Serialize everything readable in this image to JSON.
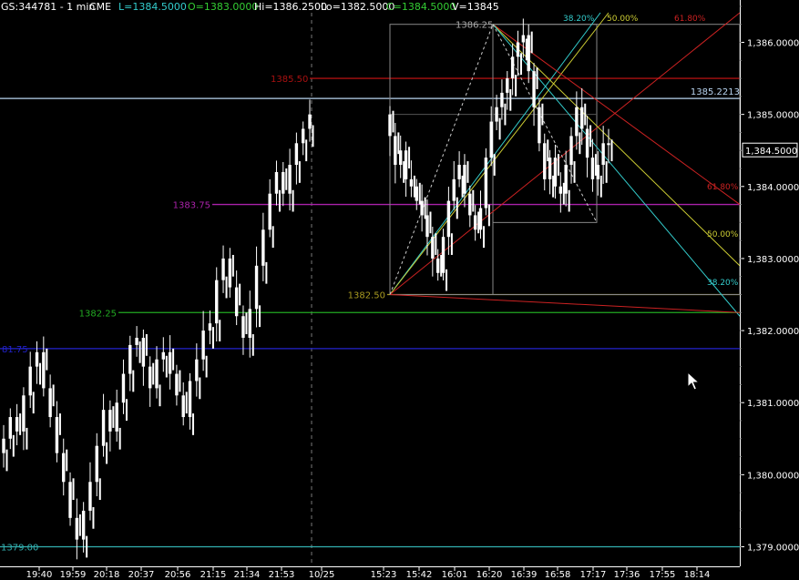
{
  "header": {
    "symbol": "GS:344781 - 1 min",
    "exchange": "CME",
    "low": "L=1384.5000",
    "open": "O=1383.0000",
    "high": "Hi=1386.2500",
    "lo": "Lo=1382.5000",
    "close": "C=1384.5000",
    "volume": "V=13845"
  },
  "colors": {
    "background": "#000000",
    "bars": "#ffffff",
    "level_red": "#aa1111",
    "level_light_blue": "#b8d4f0",
    "level_magenta": "#aa22aa",
    "level_olive": "#a89a20",
    "level_green": "#22aa22",
    "level_blue": "#2222cc",
    "level_cyan": "#33b0b0",
    "fib_cyan": "#33cccc",
    "fib_yellow": "#cccc33",
    "fib_red": "#cc2222",
    "box": "#888888"
  },
  "chart_data": {
    "type": "ohlc",
    "x_ticks": [
      "19:40",
      "19:59",
      "20:18",
      "20:37",
      "20:56",
      "21:15",
      "21:34",
      "21:53",
      "10/25",
      "15:23",
      "15:42",
      "16:01",
      "16:20",
      "16:39",
      "16:58",
      "17:17",
      "17:36",
      "17:55",
      "18:14"
    ],
    "y_ticks": [
      "1,386.0000",
      "1,385.0000",
      "1,384.0000",
      "1,383.0000",
      "1,382.0000",
      "1,381.0000",
      "1,380.0000",
      "1,379.0000"
    ],
    "y_tick_values": [
      1386,
      1385,
      1384,
      1383,
      1382,
      1381,
      1380,
      1379
    ],
    "ylim": [
      1378.78,
      1386.65
    ],
    "last_price_label": "1,384.5000",
    "last_price": 1384.5,
    "price_series": [
      1380.3,
      1380.5,
      1380.8,
      1380.6,
      1381.1,
      1381.5,
      1381.7,
      1381.2,
      1380.8,
      1380.3,
      1379.9,
      1379.4,
      1379.1,
      1379.5,
      1379.9,
      1380.4,
      1380.9,
      1380.6,
      1381.0,
      1381.4,
      1381.8,
      1381.9,
      1381.5,
      1381.2,
      1381.6,
      1381.7,
      1381.4,
      1381.1,
      1380.8,
      1381.3,
      1381.6,
      1382.0,
      1382.1,
      1382.7,
      1383.0,
      1382.6,
      1382.2,
      1381.9,
      1382.3,
      1382.9,
      1383.4,
      1383.9,
      1384.2,
      1383.9,
      1384.3,
      1384.6,
      1384.8,
      1385.0,
      1384.7,
      1384.3,
      1384.5,
      1384.1,
      1384.0,
      1383.8,
      1383.6,
      1383.3,
      1383.0,
      1382.8,
      1383.3,
      1383.8,
      1384.1,
      1384.3,
      1383.9,
      1383.6,
      1383.4,
      1383.7,
      1384.4,
      1384.9,
      1385.1,
      1385.3,
      1385.5,
      1385.8,
      1386.0,
      1386.1,
      1385.6,
      1385.1,
      1384.6,
      1384.1,
      1384.4,
      1384.0,
      1383.9,
      1384.3,
      1384.7,
      1385.1,
      1384.8,
      1384.4,
      1384.1,
      1384.3,
      1384.6
    ],
    "levels": [
      {
        "label": "1385.50",
        "value": 1385.5,
        "color": "#aa1111"
      },
      {
        "label": "1385.2213",
        "value": 1385.2213,
        "color": "#b8d4f0"
      },
      {
        "label": "1383.75",
        "value": 1383.75,
        "color": "#aa22aa"
      },
      {
        "label": "1382.50",
        "value": 1382.5,
        "color": "#a89a20"
      },
      {
        "label": "1382.25",
        "value": 1382.25,
        "color": "#22aa22"
      },
      {
        "label": "81.75",
        "value": 1381.75,
        "color": "#2222cc"
      },
      {
        "label": "1379.00",
        "value": 1379.0,
        "color": "#33b0b0"
      }
    ],
    "swing_high_label": "1386.25",
    "swing_high": 1386.25,
    "fib_labels_top": [
      "38.20%",
      "50.00%",
      "61.80%"
    ],
    "fib_labels_right": [
      "61.80%",
      "50.00%",
      "38.20%"
    ]
  }
}
